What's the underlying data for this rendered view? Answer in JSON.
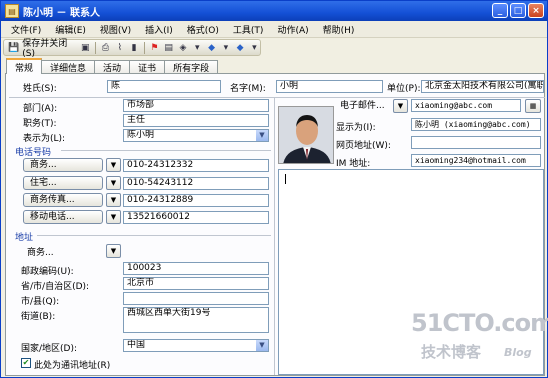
{
  "window": {
    "title": "陈小明 － 联系人",
    "app_icon": "contact-card-icon"
  },
  "menu": [
    "文件(F)",
    "编辑(E)",
    "视图(V)",
    "插入(I)",
    "格式(O)",
    "工具(T)",
    "动作(A)",
    "帮助(H)"
  ],
  "toolbar": {
    "save_close": "保存并关闭(S)"
  },
  "tabs": [
    "常规",
    "详细信息",
    "活动",
    "证书",
    "所有字段"
  ],
  "fields": {
    "name_label": "姓氏(S):",
    "name_value": "陈",
    "given_label": "名字(M):",
    "given_value": "小明",
    "company_label": "单位(P):",
    "company_value": "北京金太阳技术有限公司(寓职",
    "dept_label": "部门(A):",
    "dept_value": "市场部",
    "job_label": "职务(T):",
    "job_value": "主任",
    "display_as_label": "表示为(L):",
    "display_as_value": "陈小明"
  },
  "email": {
    "button": "电子邮件...",
    "value": "xiaoming@abc.com",
    "display_label": "显示为(I):",
    "display_value": "陈小明 (xiaoming@abc.com)",
    "web_label": "网页地址(W):",
    "web_value": "",
    "im_label": "IM 地址:",
    "im_value": "xiaoming234@hotmail.com"
  },
  "phones": {
    "section": "电话号码",
    "rows": [
      {
        "button": "商务...",
        "value": "010-24312332"
      },
      {
        "button": "住宅...",
        "value": "010-54243112"
      },
      {
        "button": "商务传真...",
        "value": "010-24312889"
      },
      {
        "button": "移动电话...",
        "value": "13521660012"
      }
    ]
  },
  "address": {
    "section": "地址",
    "type_button": "商务...",
    "postal_label": "邮政编码(U):",
    "postal_value": "100023",
    "province_label": "省/市/自治区(D):",
    "province_value": "北京市",
    "city_label": "市/县(Q):",
    "city_value": "",
    "street_label": "街道(B):",
    "street_value": "西城区西单大街19号",
    "country_label": "国家/地区(D):",
    "country_value": "中国",
    "mailing_label": "此处为通讯地址(R)"
  },
  "watermark": {
    "main": "51CTO.com",
    "sub": "技术博客",
    "blog": "Blog"
  }
}
